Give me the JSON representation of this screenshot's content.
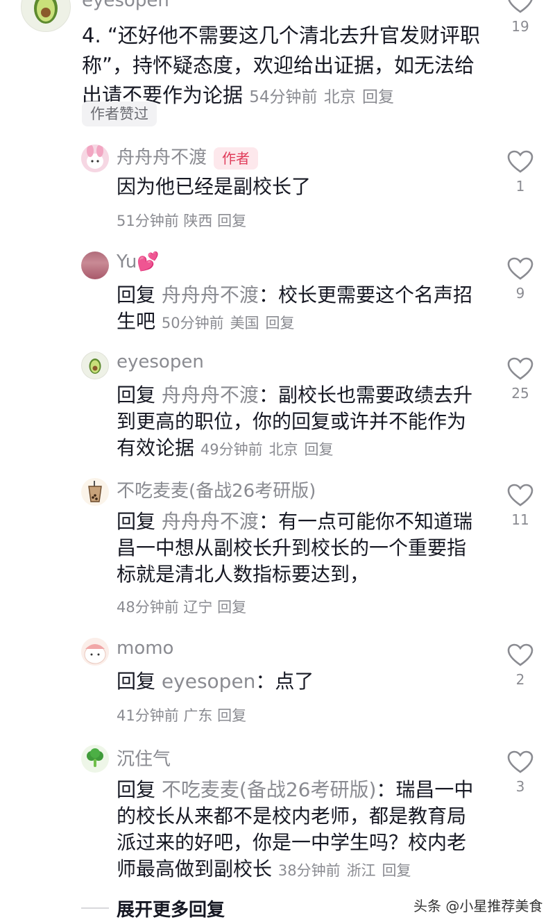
{
  "parent": {
    "avatar_icon": "avocado-icon",
    "username": "eyesopen",
    "text": "4. “还好他不需要这几个清北去升官发财评职称”，持怀疑态度，欢迎给出证据，如无法给出请不要作为论据",
    "time": "54分钟前",
    "location": "北京",
    "reply_label": "回复",
    "badge": "作者赞过",
    "likes": "19"
  },
  "replies": [
    {
      "username": "舟舟舟不渡",
      "author_tag": "作者",
      "text": "因为他已经是副校长了",
      "time": "51分钟前",
      "location": "陕西",
      "reply_label": "回复",
      "likes": "1"
    },
    {
      "username": "Yu💕",
      "prefix": "回复",
      "target": "舟舟舟不渡",
      "text": "：校长更需要这个名声招生吧",
      "time": "50分钟前",
      "location": "美国",
      "reply_label": "回复",
      "likes": "9"
    },
    {
      "username": "eyesopen",
      "prefix": "回复",
      "target": "舟舟舟不渡",
      "text": "：副校长也需要政绩去升到更高的职位，你的回复或许并不能作为有效论据",
      "time": "49分钟前",
      "location": "北京",
      "reply_label": "回复",
      "likes": "25"
    },
    {
      "username": "不吃麦麦(备战26考研版)",
      "prefix": "回复",
      "target": "舟舟舟不渡",
      "text": "：有一点可能你不知道瑞昌一中想从副校长升到校长的一个重要指标就是清北人数指标要达到，",
      "time": "48分钟前",
      "location": "辽宁",
      "reply_label": "回复",
      "likes": "11"
    },
    {
      "username": "momo",
      "prefix": "回复",
      "target": "eyesopen",
      "text": "：点了",
      "time": "41分钟前",
      "location": "广东",
      "reply_label": "回复",
      "likes": "2"
    },
    {
      "username": "沉住气",
      "prefix": "回复",
      "target": "不吃麦麦(备战26考研版)",
      "text": "：瑞昌一中的校长从来都不是校内老师，都是教育局派过来的好吧，你是一中学生吗？校内老师最高做到副校长",
      "time": "38分钟前",
      "location": "浙江",
      "reply_label": "回复",
      "likes": "3"
    }
  ],
  "expand_label": "展开更多回复",
  "watermark": "头条 @小星推荐美食",
  "colors": {
    "text": "#161823",
    "secondary": "#8a8b91",
    "author_tag_bg": "#fde8ec",
    "author_tag_fg": "#e03c5a"
  }
}
